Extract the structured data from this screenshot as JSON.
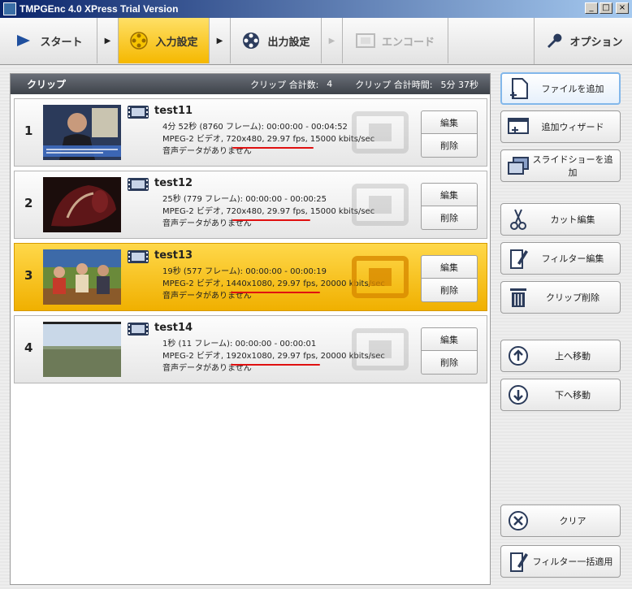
{
  "window": {
    "title": "TMPGEnc 4.0 XPress Trial Version",
    "minimize": "_",
    "maximize": "□",
    "close": "×"
  },
  "toolbar": {
    "start": "スタート",
    "input": "入力設定",
    "output": "出力設定",
    "encode": "エンコード",
    "option": "オプション",
    "arrow": "▶"
  },
  "panel": {
    "title": "クリップ",
    "count_label": "クリップ 合計数:",
    "count": "4",
    "time_label": "クリップ 合計時間:",
    "time": "5分 37秒"
  },
  "clips": [
    {
      "num": "1",
      "name": "test11",
      "line1": "4分 52秒 (8760 フレーム): 00:00:00 - 00:04:52",
      "line2": "MPEG-2 ビデオ, 720x480, 29.97 fps, 15000 kbits/sec",
      "line3": "音声データがありません",
      "edit": "編集",
      "delete": "削除",
      "selected": false
    },
    {
      "num": "2",
      "name": "test12",
      "line1": "25秒 (779 フレーム): 00:00:00 - 00:00:25",
      "line2": "MPEG-2 ビデオ, 720x480, 29.97 fps, 15000 kbits/sec",
      "line3": "音声データがありません",
      "edit": "編集",
      "delete": "削除",
      "selected": false
    },
    {
      "num": "3",
      "name": "test13",
      "line1": "19秒 (577 フレーム): 00:00:00 - 00:00:19",
      "line2": "MPEG-2 ビデオ, 1440x1080, 29.97 fps, 20000 kbits/sec",
      "line3": "音声データがありません",
      "edit": "編集",
      "delete": "削除",
      "selected": true
    },
    {
      "num": "4",
      "name": "test14",
      "line1": "1秒 (11 フレーム): 00:00:00 - 00:00:01",
      "line2": "MPEG-2 ビデオ, 1920x1080, 29.97 fps, 20000 kbits/sec",
      "line3": "音声データがありません",
      "edit": "編集",
      "delete": "削除",
      "selected": false
    }
  ],
  "side": {
    "add_file": "ファイルを追加",
    "add_wizard": "追加ウィザード",
    "add_slideshow": "スライドショーを追加",
    "cut_edit": "カット編集",
    "filter_edit": "フィルター編集",
    "clip_delete": "クリップ削除",
    "move_up": "上へ移動",
    "move_down": "下へ移動",
    "clear": "クリア",
    "filter_batch": "フィルター一括適用"
  },
  "colors": {
    "accent": "#f5b800",
    "annotation": "#e01010"
  }
}
